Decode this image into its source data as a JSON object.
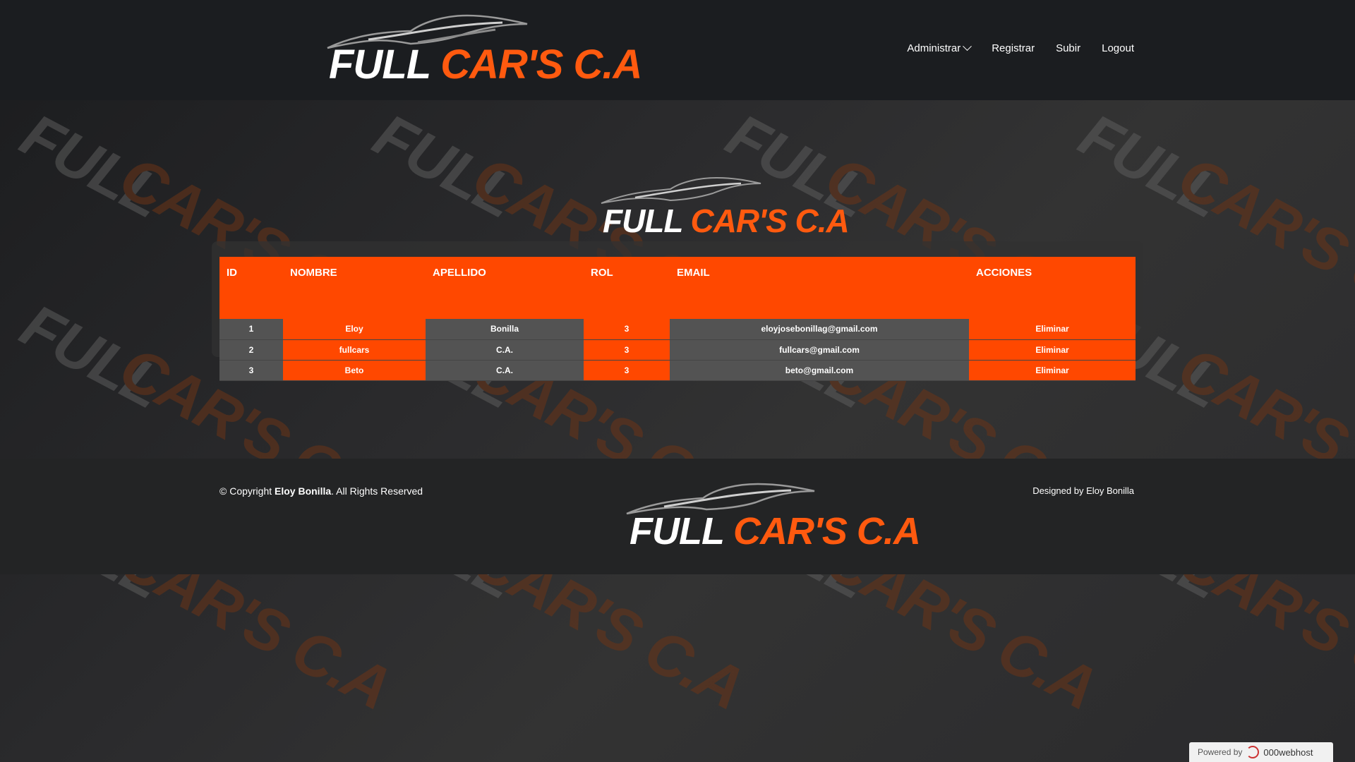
{
  "brand": {
    "word1": "FULL",
    "word2": "CAR'S C.A"
  },
  "nav": {
    "items": [
      {
        "label": "Administrar",
        "dropdown": true
      },
      {
        "label": "Registrar"
      },
      {
        "label": "Subir"
      },
      {
        "label": "Logout"
      }
    ]
  },
  "table": {
    "headers": [
      "ID",
      "NOMBRE",
      "APELLIDO",
      "ROL",
      "EMAIL",
      "ACCIONES"
    ],
    "rows": [
      {
        "id": "1",
        "nombre": "Eloy",
        "apellido": "Bonilla",
        "rol": "3",
        "email": "eloyjosebonillag@gmail.com",
        "accion": "Eliminar"
      },
      {
        "id": "2",
        "nombre": "fullcars",
        "apellido": "C.A.",
        "rol": "3",
        "email": "fullcars@gmail.com",
        "accion": "Eliminar"
      },
      {
        "id": "3",
        "nombre": "Beto",
        "apellido": "C.A.",
        "rol": "3",
        "email": "beto@gmail.com",
        "accion": "Eliminar"
      }
    ]
  },
  "footer": {
    "copy_prefix": "© Copyright ",
    "copy_name": "Eloy Bonilla",
    "copy_suffix": ". All Rights Reserved",
    "designed": "Designed by Eloy Bonilla"
  },
  "powered": {
    "label": "Powered by",
    "brand": "000webhost"
  },
  "colors": {
    "accent": "#ff4800",
    "header_bg": "#1b1d20",
    "footer_bg": "#232425",
    "cell_gray": "#535353"
  }
}
